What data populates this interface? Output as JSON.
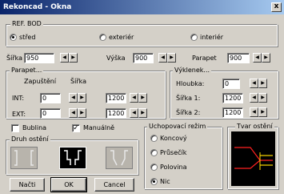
{
  "window": {
    "title": "Rekoncad - Okna",
    "close": "x"
  },
  "ref_bod": {
    "legend": "REF. BOD",
    "options": [
      "střed",
      "exteriér",
      "interiér"
    ],
    "selected": "střed"
  },
  "size": {
    "sirka_label": "Šířka",
    "sirka_value": "950",
    "vyska_label": "Výška",
    "vyska_value": "900",
    "parapet_label": "Parapet",
    "parapet_value": "900"
  },
  "parapet_group": {
    "legend": "Parapet...",
    "col1": "Zapuštění",
    "col2": "Šířka",
    "int_label": "INT:",
    "int_zapusteni": "0",
    "int_sirka": "1200",
    "ext_label": "EXT:",
    "ext_zapusteni": "0",
    "ext_sirka": "1200"
  },
  "vyklenek": {
    "legend": "Výklenek...",
    "hloubka_label": "Hloubka:",
    "hloubka_value": "0",
    "sirka1_label": "Šířka 1:",
    "sirka1_value": "1200",
    "sirka2_label": "Šířka 2:",
    "sirka2_value": "1200"
  },
  "checks": {
    "bublina_label": "Bublina",
    "bublina_checked": false,
    "manualne_label": "Manuálně",
    "manualne_checked": true
  },
  "druh_osteni": {
    "legend": "Druh ostění",
    "selected_index": 1
  },
  "uchopovaci": {
    "legend": "Uchopovací režim",
    "options": [
      "Koncový",
      "Průsečík",
      "Polovina",
      "Nic"
    ],
    "selected": "Nic"
  },
  "tvar_osteni": {
    "legend": "Tvar ostění"
  },
  "buttons": {
    "nacti": "Načti",
    "ok": "OK",
    "cancel": "Cancel"
  },
  "spin": {
    "left": "◀",
    "right": "▶"
  },
  "colors": {
    "title_start": "#0a246a",
    "preview_bg": "#000000",
    "preview_red": "#ff2020",
    "preview_yellow": "#ffd800"
  }
}
